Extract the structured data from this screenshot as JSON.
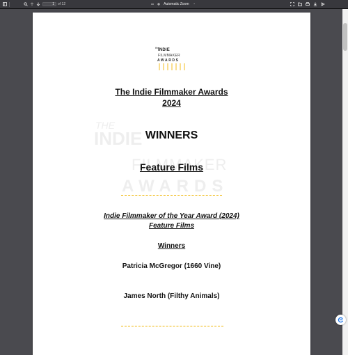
{
  "toolbar": {
    "page_number": "1",
    "page_count_label": "of 12",
    "zoom_label": "Automatic Zoom",
    "zoom_caret": "⌃"
  },
  "logo": {
    "the": "the",
    "indie": "INDIE",
    "film": "FILMMAKER",
    "awards": "AWARDS"
  },
  "watermark": {
    "the": "THE",
    "indie": "INDIE",
    "film": "FILMMAKER",
    "awards": "AWARDS"
  },
  "document": {
    "title": "The Indie Filmmaker Awards",
    "year": "2024",
    "winners_heading": "WINNERS",
    "section": "Feature Films",
    "award_name": "Indie Filmmaker of the Year Award (2024)",
    "award_category": "Feature Films",
    "winners_label": "Winners",
    "winners": [
      "Patricia McGregor (1660 Vine)",
      "James North (Filthy Animals)"
    ]
  },
  "colors": {
    "accent": "#f0b400"
  }
}
